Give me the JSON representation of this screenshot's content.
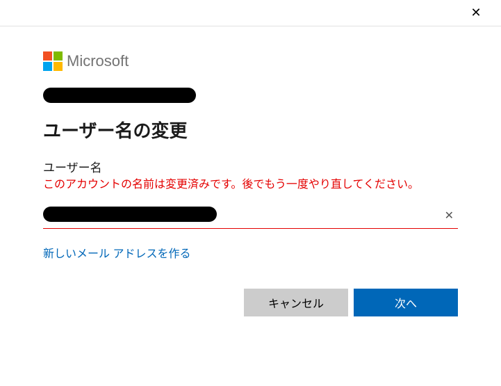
{
  "brand": "Microsoft",
  "page_title": "ユーザー名の変更",
  "field_label": "ユーザー名",
  "error_message": "このアカウントの名前は変更済みです。後でもう一度やり直してください。",
  "username_value": "",
  "link_new_email": "新しいメール アドレスを作る",
  "buttons": {
    "cancel": "キャンセル",
    "next": "次へ"
  }
}
